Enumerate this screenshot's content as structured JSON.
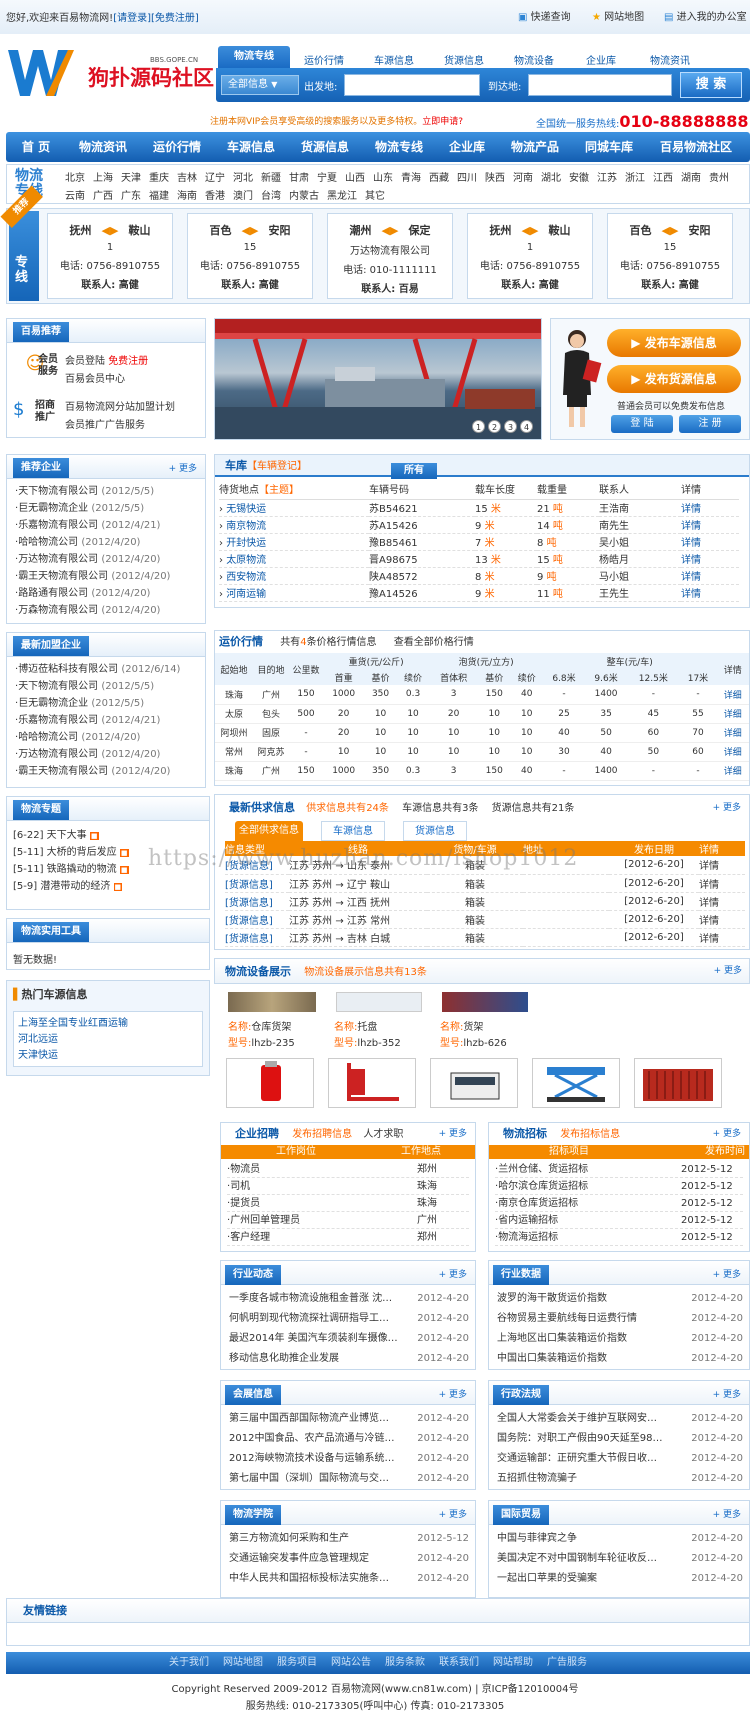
{
  "top": {
    "welcome": "您好,欢迎来百易物流网!",
    "login": "[请登录]",
    "register": "[免费注册]",
    "links": [
      "快递查询",
      "网站地图",
      "进入我的办公室"
    ]
  },
  "logo": {
    "text": "狗扑源码社区",
    "url": "BBS.GOPE.CN"
  },
  "search": {
    "tabs": [
      "物流专线",
      "运价行情",
      "车源信息",
      "货源信息",
      "物流设备",
      "企业库",
      "物流资讯"
    ],
    "select": "全部信息",
    "from_label": "出发地:",
    "to_label": "到达地:",
    "button": "搜 索",
    "vip_text": "注册本网VIP会员享受高级的搜索服务以及更多特权。",
    "apply": "立即申请?",
    "hotline_label": "全国统一服务热线:",
    "hotline": "010-88888888"
  },
  "nav": [
    "首 页",
    "物流资讯",
    "运价行情",
    "车源信息",
    "货源信息",
    "物流专线",
    "企业库",
    "物流产品",
    "同城车库",
    "百易物流社区"
  ],
  "cities": {
    "label": "物流专线",
    "row1": [
      "北京",
      "上海",
      "天津",
      "重庆",
      "吉林",
      "辽宁",
      "河北",
      "新疆",
      "甘肃",
      "宁夏",
      "山西",
      "山东",
      "青海",
      "西藏",
      "四川",
      "陕西",
      "河南",
      "湖北",
      "安徽",
      "江苏",
      "浙江",
      "江西",
      "湖南",
      "贵州"
    ],
    "row2": [
      "云南",
      "广西",
      "广东",
      "福建",
      "海南",
      "香港",
      "澳门",
      "台湾",
      "内蒙古",
      "黑龙江",
      "其它"
    ]
  },
  "lines": {
    "tag": "推荐",
    "label": "专线",
    "items": [
      {
        "from": "抚州",
        "to": "鞍山",
        "mid": "1",
        "phone": "电话: 0756-8910755",
        "contact": "联系人: 高健"
      },
      {
        "from": "百色",
        "to": "安阳",
        "mid": "15",
        "phone": "电话: 0756-8910755",
        "contact": "联系人: 高健"
      },
      {
        "from": "潮州",
        "to": "保定",
        "mid": "万达物流有限公司",
        "phone": "电话: 010-1111111",
        "contact": "联系人: 百易"
      },
      {
        "from": "抚州",
        "to": "鞍山",
        "mid": "1",
        "phone": "电话: 0756-8910755",
        "contact": "联系人: 高健"
      },
      {
        "from": "百色",
        "to": "安阳",
        "mid": "15",
        "phone": "电话: 0756-8910755",
        "contact": "联系人: 高健"
      }
    ]
  },
  "baiyi": {
    "title": "百易推荐",
    "member": "会员服务",
    "member_links": [
      "会员登陆",
      "免费注册",
      "百易会员中心"
    ],
    "promo": "招商推广",
    "promo_links": [
      "百易物流网分站加盟计划",
      "会员推广广告服务"
    ]
  },
  "slider": {
    "pages": [
      "1",
      "2",
      "3",
      "4"
    ]
  },
  "publish": {
    "btn1": "发布车源信息",
    "btn2": "发布货源信息",
    "note": "普通会员可以免费发布信息",
    "login": "登 陆",
    "register": "注 册"
  },
  "rec": {
    "title": "推荐企业",
    "more": "+ 更多",
    "items": [
      {
        "n": "天下物流有限公司",
        "d": "(2012/5/5)"
      },
      {
        "n": "巨无霸物流企业",
        "d": "(2012/5/5)"
      },
      {
        "n": "乐嘉物流有限公司",
        "d": "(2012/4/21)"
      },
      {
        "n": "哈哈物流公司",
        "d": "(2012/4/20)"
      },
      {
        "n": "万达物流有限公司",
        "d": "(2012/4/20)"
      },
      {
        "n": "霸王天物流有限公司",
        "d": "(2012/4/20)"
      },
      {
        "n": "路路通有限公司",
        "d": "(2012/4/20)"
      },
      {
        "n": "万森物流有限公司",
        "d": "(2012/4/20)"
      }
    ]
  },
  "newjoin": {
    "title": "最新加盟企业",
    "items": [
      {
        "n": "博迈莅粘科技有限公司",
        "d": "(2012/6/14)"
      },
      {
        "n": "天下物流有限公司",
        "d": "(2012/5/5)"
      },
      {
        "n": "巨无霸物流企业",
        "d": "(2012/5/5)"
      },
      {
        "n": "乐嘉物流有限公司",
        "d": "(2012/4/21)"
      },
      {
        "n": "哈哈物流公司",
        "d": "(2012/4/20)"
      },
      {
        "n": "万达物流有限公司",
        "d": "(2012/4/20)"
      },
      {
        "n": "霸王天物流有限公司",
        "d": "(2012/4/20)"
      }
    ]
  },
  "topics": {
    "title": "物流专题",
    "items": [
      "[6-22] 天下大事",
      "[5-11] 大桥的背后发应",
      "[5-11] 铁路撬动的物流",
      "[5-9] 潜港带动的经济"
    ]
  },
  "tools": {
    "title": "物流实用工具",
    "empty": "暂无数据!"
  },
  "hotcars": {
    "title": "热门车源信息",
    "items": [
      "上海至全国专业红酉运输",
      "河北远运",
      "天津快运"
    ]
  },
  "garage": {
    "title": "车库",
    "sub": "【车辆登记】",
    "tab": "所有",
    "headers": [
      "待货地点",
      "【主题】",
      "车辆号码",
      "载车长度",
      "载重量",
      "联系人",
      "详情"
    ],
    "rows": [
      [
        "无锡快运",
        "苏B54621",
        "15",
        "米",
        "21",
        "吨",
        "王浩南",
        "详情"
      ],
      [
        "南京物流",
        "苏A15426",
        "9",
        "米",
        "14",
        "吨",
        "南先生",
        "详情"
      ],
      [
        "开封快运",
        "豫B85461",
        "7",
        "米",
        "8",
        "吨",
        "吴小姐",
        "详情"
      ],
      [
        "太原物流",
        "晋A98675",
        "13",
        "米",
        "15",
        "吨",
        "杨皓月",
        "详情"
      ],
      [
        "西安物流",
        "陕A48572",
        "8",
        "米",
        "9",
        "吨",
        "马小姐",
        "详情"
      ],
      [
        "河南运输",
        "豫A14526",
        "9",
        "米",
        "11",
        "吨",
        "王先生",
        "详情"
      ]
    ]
  },
  "freight": {
    "title": "运价行情",
    "count_pre": "共有",
    "count": "4",
    "count_post": "条价格行情信息",
    "all": "查看全部价格行情",
    "h_from": "起始地",
    "h_to": "目的地",
    "h_km": "公里数",
    "h_heavy": "重货(元/公斤)",
    "h_light": "泡货(元/立方)",
    "h_truck": "整车(元/车)",
    "h_detail": "详情",
    "sub": [
      "首重",
      "基价",
      "续价",
      "首体积",
      "基价",
      "续价",
      "6.8米",
      "9.6米",
      "12.5米",
      "17米"
    ],
    "rows": [
      [
        "珠海",
        "广州",
        "150",
        "1000",
        "350",
        "0.3",
        "3",
        "150",
        "40",
        "-",
        "1400",
        "-",
        "-",
        "详细"
      ],
      [
        "太原",
        "包头",
        "500",
        "20",
        "10",
        "10",
        "20",
        "10",
        "10",
        "25",
        "35",
        "45",
        "55",
        "详细"
      ],
      [
        "阿坝州",
        "固原",
        "-",
        "20",
        "10",
        "10",
        "10",
        "10",
        "10",
        "40",
        "50",
        "60",
        "70",
        "详细"
      ],
      [
        "常州",
        "阿克苏",
        "-",
        "10",
        "10",
        "10",
        "10",
        "10",
        "10",
        "30",
        "40",
        "50",
        "60",
        "详细"
      ],
      [
        "珠海",
        "广州",
        "150",
        "1000",
        "350",
        "0.3",
        "3",
        "150",
        "40",
        "-",
        "1400",
        "-",
        "-",
        "详细"
      ]
    ]
  },
  "supply": {
    "title": "最新供求信息",
    "sub_a": "供求信息共有",
    "sub_n": "24",
    "sub_b": "条",
    "car_info": "车源信息共有3条",
    "goods_info": "货源信息共有21条",
    "more": "+ 更多",
    "tabs": [
      "全部供求信息",
      "车源信息",
      "货源信息"
    ],
    "headers": [
      "信息类型",
      "线路",
      "货物/车源",
      "地址",
      "发布日期",
      "详情"
    ],
    "rows": [
      [
        "[货源信息]",
        "江苏 苏州 → 山东 泰州",
        "箱装",
        "[2012-6-20]",
        "详情"
      ],
      [
        "[货源信息]",
        "江苏 苏州 → 辽宁 鞍山",
        "箱装",
        "[2012-6-20]",
        "详情"
      ],
      [
        "[货源信息]",
        "江苏 苏州 → 江西 抚州",
        "箱装",
        "[2012-6-20]",
        "详情"
      ],
      [
        "[货源信息]",
        "江苏 苏州 → 江苏 常州",
        "箱装",
        "[2012-6-20]",
        "详情"
      ],
      [
        "[货源信息]",
        "江苏 苏州 → 吉林 白城",
        "箱装",
        "[2012-6-20]",
        "详情"
      ]
    ]
  },
  "watermark": "https://www.huzhan.com/ishop1012",
  "equip": {
    "title": "物流设备展示",
    "sub": "物流设备展示信息共有13条",
    "more": "+ 更多",
    "items": [
      {
        "name_label": "名称:",
        "name": "仓库货架",
        "model_label": "型号:",
        "model": "lhzb-235"
      },
      {
        "name_label": "名称:",
        "name": "托盘",
        "model_label": "型号:",
        "model": "lhzb-352"
      },
      {
        "name_label": "名称:",
        "name": "货架",
        "model_label": "型号:",
        "model": "lhzb-626"
      }
    ]
  },
  "jobs": {
    "title": "企业招聘",
    "sub": "发布招聘信息",
    "sub2": "人才求职",
    "more": "+ 更多",
    "h1": "工作岗位",
    "h2": "工作地点",
    "rows": [
      [
        "物流员",
        "郑州"
      ],
      [
        "司机",
        "珠海"
      ],
      [
        "提货员",
        "珠海"
      ],
      [
        "广州回单管理员",
        "广州"
      ],
      [
        "客户经理",
        "郑州"
      ]
    ]
  },
  "bids": {
    "title": "物流招标",
    "sub": "发布招标信息",
    "more": "+ 更多",
    "h1": "招标项目",
    "h2": "发布时间",
    "rows": [
      [
        "兰州仓储、货运招标",
        "2012-5-12"
      ],
      [
        "哈尔滨仓库货运招标",
        "2012-5-12"
      ],
      [
        "南京仓库货运招标",
        "2012-5-12"
      ],
      [
        "省内运输招标",
        "2012-5-12"
      ],
      [
        "物流海运招标",
        "2012-5-12"
      ]
    ]
  },
  "news": [
    {
      "title": "行业动态",
      "more": "+ 更多",
      "items": [
        [
          "一季度各城市物流设施租金普涨 沈…",
          "2012-4-20"
        ],
        [
          "何帆明到现代物流探社调研指导工…",
          "2012-4-20"
        ],
        [
          "最迟2014年 美国汽车须装刹车摄像…",
          "2012-4-20"
        ],
        [
          "移动信息化助推企业发展",
          "2012-4-20"
        ]
      ]
    },
    {
      "title": "行业数据",
      "more": "+ 更多",
      "items": [
        [
          "波罗的海干散货运价指数",
          "2012-4-20"
        ],
        [
          "谷物贸易主要航线每日运费行情",
          "2012-4-20"
        ],
        [
          "上海地区出口集装箱运价指数",
          "2012-4-20"
        ],
        [
          "中国出口集装箱运价指数",
          "2012-4-20"
        ]
      ]
    },
    {
      "title": "会展信息",
      "more": "+ 更多",
      "items": [
        [
          "第三届中国西部国际物流产业博览…",
          "2012-4-20"
        ],
        [
          "2012中国食品、农产品流通与冷链…",
          "2012-4-20"
        ],
        [
          "2012海峡物流技术设备与运输系统…",
          "2012-4-20"
        ],
        [
          "第七届中国（深圳）国际物流与交…",
          "2012-4-20"
        ]
      ]
    },
    {
      "title": "行政法规",
      "more": "+ 更多",
      "items": [
        [
          "全国人大常委会关于维护互联网安…",
          "2012-4-20"
        ],
        [
          "国务院：对职工产假由90天延至98…",
          "2012-4-20"
        ],
        [
          "交通运输部：正研究重大节假日收…",
          "2012-4-20"
        ],
        [
          "五招抓住物流骗子",
          "2012-4-20"
        ]
      ]
    },
    {
      "title": "物流学院",
      "more": "+ 更多",
      "items": [
        [
          "第三方物流如何采购和生产",
          "2012-5-12"
        ],
        [
          "交通运输突发事件应急管理规定",
          "2012-4-20"
        ],
        [
          "中华人民共和国招标投标法实施条…",
          "2012-4-20"
        ]
      ]
    },
    {
      "title": "国际贸易",
      "more": "+ 更多",
      "items": [
        [
          "中国与菲律宾之争",
          "2012-4-20"
        ],
        [
          "美国决定不对中国钢制车轮征收反…",
          "2012-4-20"
        ],
        [
          "一起出口苹果的受骗案",
          "2012-4-20"
        ]
      ]
    }
  ],
  "friend": {
    "title": "友情链接"
  },
  "footer": {
    "links": [
      "关于我们",
      "网站地图",
      "服务项目",
      "网站公告",
      "服务条款",
      "联系我们",
      "网站帮助",
      "广告服务"
    ],
    "copy": "Copyright Reserved 2009-2012 百易物流网(www.cn81w.com) | 京ICP备12010004号",
    "service": "服务热线: 010-2173305(呼叫中心)  传真: 010-2173305"
  },
  "colors": {
    "brand": "#0b5fb5",
    "accent": "#f60",
    "hotline": "#e60012"
  }
}
